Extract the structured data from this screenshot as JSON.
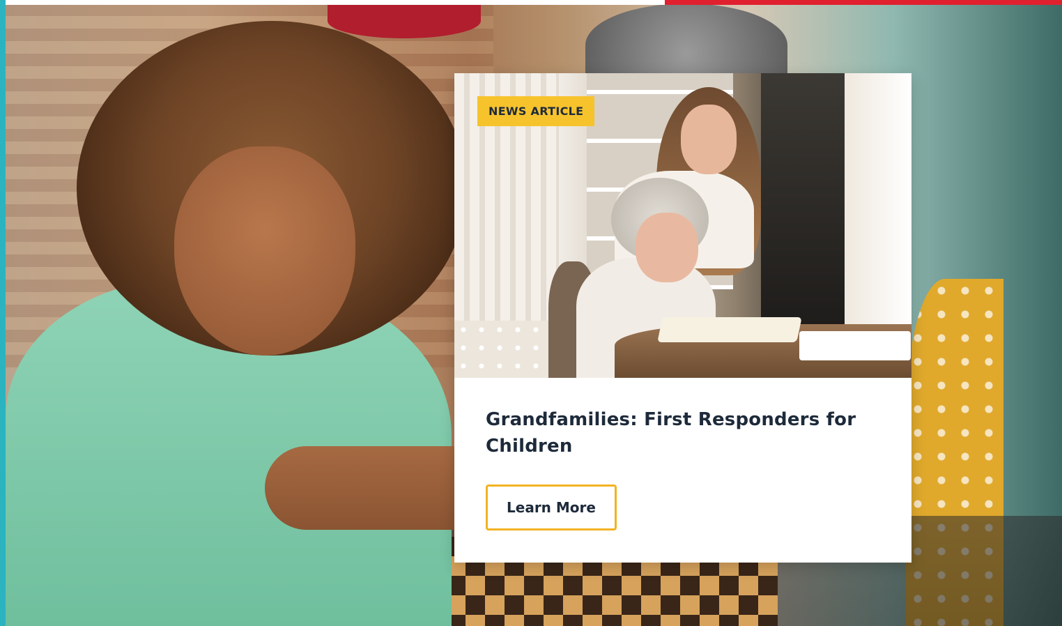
{
  "card": {
    "badge": "NEWS ARTICLE",
    "title": "Grandfamilies: First Responders for Children",
    "button_label": "Learn More"
  },
  "colors": {
    "accent_left": "#2bb3c0",
    "accent_top_red": "#e0202f",
    "badge_bg": "#f6c32c",
    "button_border": "#f2b323",
    "title_text": "#1d2a3a"
  }
}
